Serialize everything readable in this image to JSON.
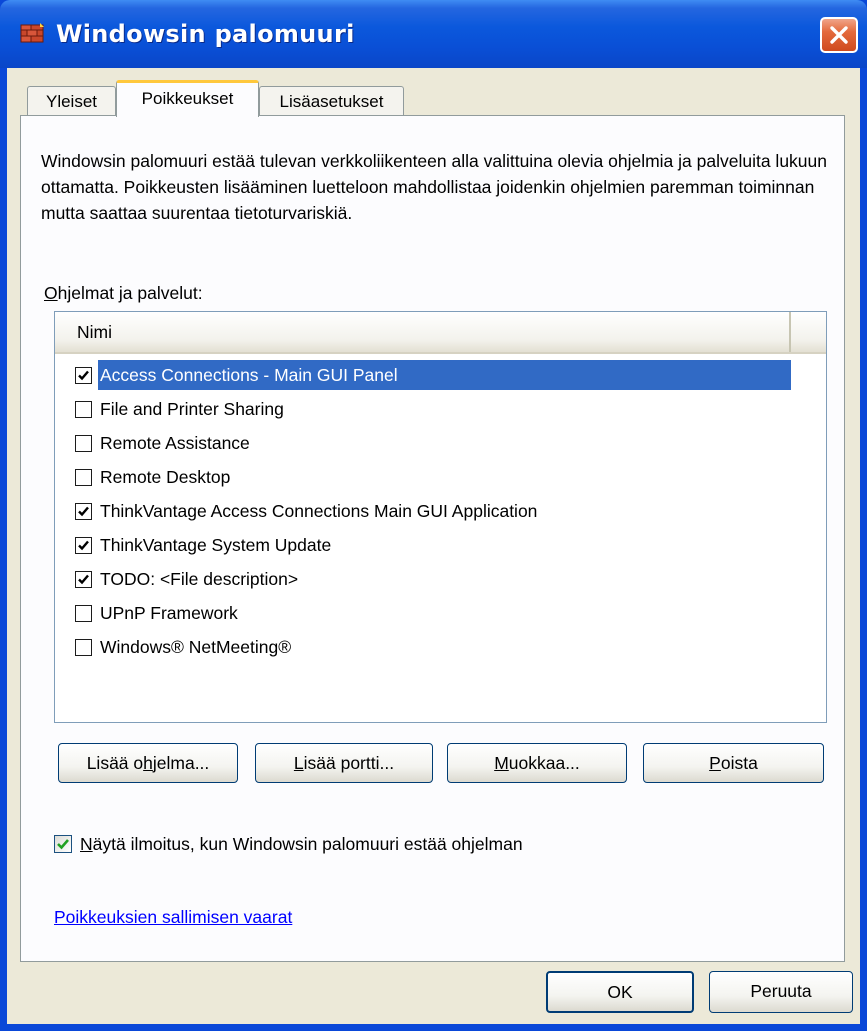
{
  "window": {
    "title": "Windowsin palomuuri",
    "title_bar_color": "#0a4fd6"
  },
  "tabs": [
    {
      "label": "Yleiset",
      "active": false
    },
    {
      "label": "Poikkeukset",
      "active": true
    },
    {
      "label": "Lisäasetukset",
      "active": false
    }
  ],
  "description": "Windowsin palomuuri estää tulevan verkkoliikenteen alla valittuina olevia ohjelmia ja palveluita lukuun ottamatta. Poikkeusten lisääminen luetteloon mahdollistaa joidenkin ohjelmien paremman toiminnan mutta saattaa suurentaa tietoturvariskiä.",
  "programs": {
    "label_prefix": "O",
    "label_rest": "hjelmat ja palvelut:",
    "column_header": "Nimi",
    "items": [
      {
        "label": "Access Connections - Main GUI Panel",
        "checked": true,
        "selected": true
      },
      {
        "label": "File and Printer Sharing",
        "checked": false,
        "selected": false
      },
      {
        "label": "Remote Assistance",
        "checked": false,
        "selected": false
      },
      {
        "label": "Remote Desktop",
        "checked": false,
        "selected": false
      },
      {
        "label": "ThinkVantage Access Connections Main GUI Application",
        "checked": true,
        "selected": false
      },
      {
        "label": "ThinkVantage System Update",
        "checked": true,
        "selected": false
      },
      {
        "label": "TODO: <File description>",
        "checked": true,
        "selected": false
      },
      {
        "label": "UPnP Framework",
        "checked": false,
        "selected": false
      },
      {
        "label": "Windows® NetMeeting®",
        "checked": false,
        "selected": false
      }
    ]
  },
  "buttons": {
    "add_program": {
      "pre": "Lisää o",
      "u": "h",
      "post": "jelma..."
    },
    "add_port": {
      "pre": "",
      "u": "L",
      "post": "isää portti..."
    },
    "edit": {
      "pre": "",
      "u": "M",
      "post": "uokkaa..."
    },
    "remove": {
      "pre": "",
      "u": "P",
      "post": "oista"
    },
    "ok": "OK",
    "cancel": "Peruuta"
  },
  "notify": {
    "checked": true,
    "pre": "",
    "u": "N",
    "post": "äytä ilmoitus, kun Windowsin palomuuri estää ohjelman"
  },
  "link": "Poikkeuksien sallimisen vaarat",
  "colors": {
    "selection": "#316ac5",
    "dialog_bg": "#ece9d8",
    "close_button": "#e46a3c",
    "check_green": "#21a121"
  }
}
